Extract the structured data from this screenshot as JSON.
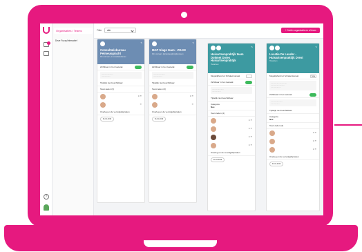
{
  "nav": {
    "active": "Organisaties / Teams",
    "item": "Deze Fuzzy/Interactief"
  },
  "topbar": {
    "filter_label": "Filter",
    "filter_value": "alle",
    "create_label": "+ Creëer organisatie en of team"
  },
  "cards": [
    {
      "title": "Consultatiebureau Pelmeusgracht",
      "subtitle": "Dit is de team, in consultatiebureau",
      "row1": "Zichtbaar in het zoekvak",
      "row2": "Tijdelijk niet beschikbaar",
      "members": "Team leden (3)",
      "meetings": "Overleg en de vervolgafspraken",
      "date": "01-01-2019"
    },
    {
      "title": "MAP triage team - ZOAM",
      "subtitle": "Dit is de team, klanten/jeugdzorgfenomeen",
      "row1": "Zichtbaar in het zoekvak",
      "row2": "Tijdelijk niet beschikbaar",
      "members": "Team leden (2)",
      "meetings": "Overleg en de vervolgafspraken",
      "date": "01-01-2019"
    },
    {
      "title": "Huisartsenpraktijk team Dokmet Dotes Huisartsenpraktijk",
      "subtitle": "Huisartsen",
      "row1": "Mogelijkheid tot Schakel kanaal",
      "row2": "Zichtbaar in het zoekvak",
      "row3": "Tijdelijk niet beschikbaar",
      "members": "Team leden (4)",
      "meetings": "Overleg en de vervolgafspraken",
      "date": "01-01-2019"
    },
    {
      "title": "Locatie De Lauder - Huisartsenpraktijk Drent",
      "subtitle": "Huisartsen",
      "row1": "Mogelijkheid tot Schakel kanaal",
      "row2": "Zichtbaar in het zoekvak",
      "row3": "Tijdelijk niet beschikbaar",
      "members": "Team leden (3)",
      "meetings": "Overleg en de vervolgafspraken",
      "date": "01-01-2019"
    }
  ],
  "labels": {
    "save": "Save",
    "category_label": "Categorie",
    "category_value": "Nee"
  }
}
